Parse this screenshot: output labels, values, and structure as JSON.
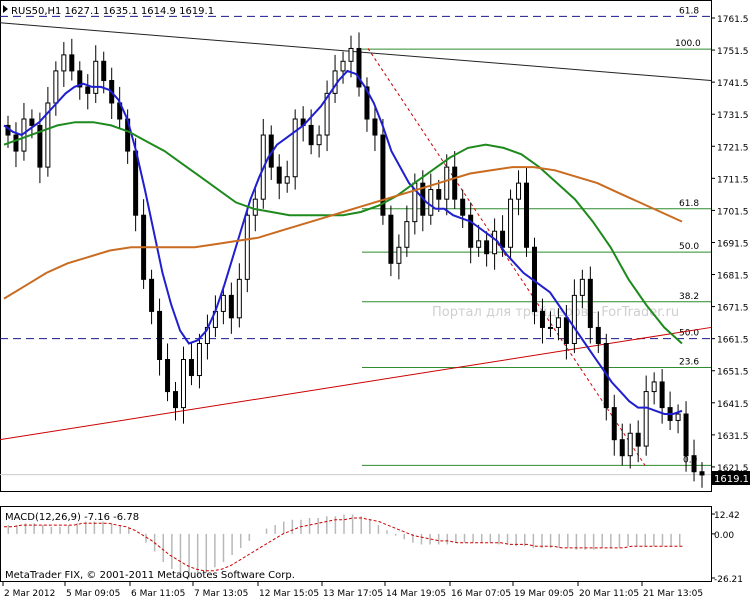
{
  "window": {
    "symbol_line": "RUS50,H1  1627.1 1635.1 1614.9 1619.1",
    "macd_label": "MACD(12,26,9) -7.16 -6.78",
    "copyright": "MetaTrader FIX, © 2001-2011 MetaQuotes Software Corp.",
    "watermark": "Портал для трейдеров - ForTrader.ru",
    "last_price": "1619.1"
  },
  "colors": {
    "candles": "#000000",
    "ma_fast": "#1f1fd0",
    "ma_mid": "#1e8a1e",
    "ma_slow": "#c96b20",
    "trendlines": "#cc0000",
    "fib_levels": "#2e8b2e",
    "dashed_levels": "#1a1a8c",
    "macd_signal": "#cc0000",
    "macd_hist": "#b8b8b8"
  },
  "chart_data": [
    {
      "type": "candlestick",
      "timeframe": "H1",
      "y_ticks": [
        "1761.5",
        "1751.5",
        "1741.5",
        "1731.5",
        "1721.5",
        "1711.5",
        "1701.5",
        "1691.5",
        "1681.5",
        "1671.5",
        "1661.5",
        "1651.5",
        "1641.5",
        "1631.5",
        "1621.5",
        "1611.5"
      ],
      "ylim": [
        1608,
        1764
      ],
      "x_ticks": [
        "2 Mar 2012",
        "5 Mar 09:05",
        "6 Mar 11:05",
        "7 Mar 13:05",
        "12 Mar 15:05",
        "13 Mar 17:05",
        "14 Mar 19:05",
        "16 Mar 07:05",
        "19 Mar 09:05",
        "20 Mar 11:05",
        "21 Mar 13:05"
      ],
      "closes": [
        1725,
        1720,
        1730,
        1728,
        1715,
        1735,
        1745,
        1750,
        1745,
        1740,
        1738,
        1748,
        1742,
        1735,
        1730,
        1720,
        1700,
        1680,
        1670,
        1655,
        1645,
        1640,
        1655,
        1650,
        1660,
        1665,
        1670,
        1675,
        1668,
        1680,
        1700,
        1705,
        1725,
        1715,
        1710,
        1712,
        1730,
        1728,
        1722,
        1725,
        1738,
        1745,
        1748,
        1752,
        1740,
        1730,
        1725,
        1700,
        1685,
        1690,
        1698,
        1710,
        1700,
        1708,
        1705,
        1715,
        1705,
        1700,
        1690,
        1692,
        1688,
        1695,
        1690,
        1705,
        1710,
        1690,
        1670,
        1665,
        1665,
        1668,
        1660,
        1675,
        1680,
        1665,
        1660,
        1640,
        1630,
        1625,
        1632,
        1628,
        1645,
        1648,
        1640,
        1636,
        1638,
        1625,
        1620,
        1619
      ],
      "fib_levels": [
        {
          "label": "61.8",
          "value": 1762.0
        },
        {
          "label": "100.0",
          "value": 1751.8
        },
        {
          "label": "61.8",
          "value": 1702.0
        },
        {
          "label": "50.0",
          "value": 1688.5
        },
        {
          "label": "38.2",
          "value": 1673.0
        },
        {
          "label": "50.0",
          "value": 1661.5
        },
        {
          "label": "23.6",
          "value": 1652.5
        },
        {
          "label": "0.0",
          "value": 1622.0
        }
      ],
      "moving_averages": [
        {
          "values": [
            1728,
            1726,
            1725,
            1727,
            1729,
            1732,
            1735,
            1738,
            1740,
            1741,
            1740,
            1740,
            1739,
            1736,
            1730,
            1720,
            1708,
            1695,
            1682,
            1672,
            1664,
            1660,
            1661,
            1664,
            1670,
            1678,
            1687,
            1696,
            1705,
            1712,
            1718,
            1722,
            1724,
            1726,
            1728,
            1731,
            1734,
            1738,
            1742,
            1745,
            1744,
            1740,
            1735,
            1728,
            1720,
            1715,
            1710,
            1707,
            1704,
            1702,
            1702,
            1700,
            1699,
            1698,
            1696,
            1694,
            1692,
            1688,
            1685,
            1682,
            1680,
            1678,
            1676,
            1672,
            1668,
            1664,
            1660,
            1656,
            1652,
            1648,
            1645,
            1642,
            1640,
            1640,
            1639,
            1638,
            1638,
            1639
          ]
        },
        {
          "values": [
            1722,
            1724,
            1726,
            1728,
            1729,
            1729,
            1728,
            1726,
            1723,
            1720,
            1716,
            1712,
            1708,
            1704,
            1702,
            1701,
            1700,
            1700,
            1700,
            1700,
            1701,
            1703,
            1706,
            1710,
            1714,
            1718,
            1721,
            1722,
            1721,
            1719,
            1715,
            1710,
            1705,
            1698,
            1690,
            1680,
            1672,
            1665,
            1660
          ]
        },
        {
          "values": [
            1674,
            1678,
            1682,
            1685,
            1687,
            1689,
            1690,
            1690,
            1690,
            1690,
            1691,
            1692,
            1693,
            1695,
            1697,
            1699,
            1701,
            1703,
            1705,
            1707,
            1709,
            1711,
            1713,
            1714,
            1715,
            1715,
            1714,
            1712,
            1710,
            1707,
            1704,
            1701,
            1698
          ]
        }
      ]
    },
    {
      "type": "bar",
      "name": "MACD(12,26,9)",
      "y_ticks": [
        "12.42",
        "0.00",
        "-26.21"
      ],
      "ylim": [
        -26.21,
        12.42
      ],
      "values": [
        5,
        5,
        6,
        6,
        5,
        4,
        4,
        5,
        6,
        7,
        7,
        7,
        6,
        5,
        3,
        0,
        -5,
        -10,
        -16,
        -20,
        -23,
        -25,
        -24,
        -22,
        -19,
        -16,
        -12,
        -8,
        -4,
        0,
        3,
        5,
        7,
        8,
        8,
        9,
        9,
        10,
        10,
        11,
        11,
        10,
        8,
        5,
        2,
        -1,
        -3,
        -5,
        -6,
        -6,
        -6,
        -6,
        -5,
        -5,
        -5,
        -5,
        -5,
        -6,
        -6,
        -7,
        -7,
        -8,
        -8,
        -8,
        -8,
        -8,
        -9,
        -9,
        -9,
        -8,
        -8,
        -8,
        -7,
        -7,
        -7,
        -7,
        -7,
        -7,
        -7
      ],
      "signal": [
        4,
        4,
        5,
        5,
        5,
        5,
        5,
        5,
        5,
        6,
        6,
        6,
        6,
        5,
        4,
        2,
        -1,
        -4,
        -8,
        -12,
        -15,
        -18,
        -20,
        -21,
        -21,
        -20,
        -18,
        -15,
        -12,
        -9,
        -6,
        -3,
        0,
        2,
        4,
        5,
        6,
        7,
        8,
        8,
        9,
        9,
        8,
        7,
        5,
        3,
        1,
        -1,
        -2,
        -3,
        -4,
        -4,
        -5,
        -5,
        -5,
        -5,
        -5,
        -5,
        -6,
        -6,
        -6,
        -7,
        -7,
        -7,
        -8,
        -8,
        -8,
        -8,
        -8,
        -8,
        -8,
        -8,
        -7,
        -7,
        -7,
        -7,
        -7,
        -7,
        -7
      ]
    }
  ]
}
